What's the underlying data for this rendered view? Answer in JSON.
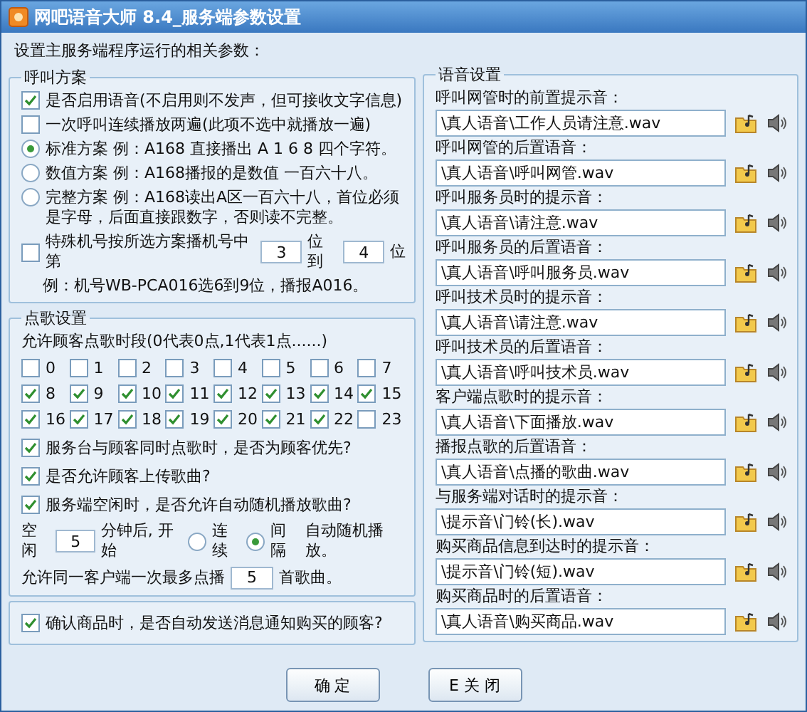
{
  "window": {
    "title": "网吧语音大师 8.4_服务端参数设置"
  },
  "intro": "设置主服务端程序运行的相关参数：",
  "call_scheme": {
    "title": "呼叫方案",
    "items": [
      {
        "kind": "checkbox",
        "label": "是否启用语音(不启用则不发声，但可接收文字信息)",
        "checked": true
      },
      {
        "kind": "checkbox",
        "label": "一次呼叫连续播放两遍(此项不选中就播放一遍)",
        "checked": false
      },
      {
        "kind": "radio",
        "label": "标准方案 例：A168 直接播出 A 1 6 8 四个字符。",
        "selected": true
      },
      {
        "kind": "radio",
        "label": "数值方案 例：A168播报的是数值 一百六十八。",
        "selected": false
      },
      {
        "kind": "radio",
        "label": "完整方案 例：A168读出A区一百六十八，首位必须是字母，后面直接跟数字，否则读不完整。",
        "selected": false
      }
    ],
    "special": {
      "checked": false,
      "label": "特殊机号按所选方案播机号中第",
      "from": "3",
      "middle": "位到",
      "to": "4",
      "end": "位",
      "example": "例：机号WB-PCA016选6到9位，播报A016。"
    }
  },
  "song_settings": {
    "title": "点歌设置",
    "hours_label": "允许顾客点歌时段(0代表0点,1代表1点......)",
    "hours": [
      {
        "label": "0",
        "checked": false
      },
      {
        "label": "1",
        "checked": false
      },
      {
        "label": "2",
        "checked": false
      },
      {
        "label": "3",
        "checked": false
      },
      {
        "label": "4",
        "checked": false
      },
      {
        "label": "5",
        "checked": false
      },
      {
        "label": "6",
        "checked": false
      },
      {
        "label": "7",
        "checked": false
      },
      {
        "label": "8",
        "checked": true
      },
      {
        "label": "9",
        "checked": true
      },
      {
        "label": "10",
        "checked": true
      },
      {
        "label": "11",
        "checked": true
      },
      {
        "label": "12",
        "checked": true
      },
      {
        "label": "13",
        "checked": true
      },
      {
        "label": "14",
        "checked": true
      },
      {
        "label": "15",
        "checked": true
      },
      {
        "label": "16",
        "checked": true
      },
      {
        "label": "17",
        "checked": true
      },
      {
        "label": "18",
        "checked": true
      },
      {
        "label": "19",
        "checked": true
      },
      {
        "label": "20",
        "checked": true
      },
      {
        "label": "21",
        "checked": true
      },
      {
        "label": "22",
        "checked": true
      },
      {
        "label": "23",
        "checked": false
      }
    ],
    "options": [
      {
        "label": "服务台与顾客同时点歌时，是否为顾客优先?",
        "checked": true
      },
      {
        "label": "是否允许顾客上传歌曲?",
        "checked": true
      },
      {
        "label": "服务端空闲时，是否允许自动随机播放歌曲?",
        "checked": true
      }
    ],
    "idle": {
      "before": "空闲",
      "minutes": "5",
      "after": "分钟后, 开始",
      "modes": [
        {
          "label": "连续",
          "selected": false
        },
        {
          "label": "间隔",
          "selected": true
        }
      ],
      "tail": "自动随机播放。"
    },
    "limit": {
      "before": "允许同一客户端一次最多点播",
      "value": "5",
      "after": "首歌曲。"
    }
  },
  "confirm_option": {
    "label": "确认商品时，是否自动发送消息通知购买的顾客?",
    "checked": true
  },
  "voice_settings": {
    "title": "语音设置",
    "entries": [
      {
        "label": "呼叫网管时的前置提示音：",
        "value": "\\真人语音\\工作人员请注意.wav"
      },
      {
        "label": "呼叫网管的后置语音：",
        "value": "\\真人语音\\呼叫网管.wav"
      },
      {
        "label": "呼叫服务员时的提示音：",
        "value": "\\真人语音\\请注意.wav"
      },
      {
        "label": "呼叫服务员的后置语音：",
        "value": "\\真人语音\\呼叫服务员.wav"
      },
      {
        "label": "呼叫技术员时的提示音：",
        "value": "\\真人语音\\请注意.wav"
      },
      {
        "label": "呼叫技术员的后置语音：",
        "value": "\\真人语音\\呼叫技术员.wav"
      },
      {
        "label": "客户端点歌时的提示音：",
        "value": "\\真人语音\\下面播放.wav"
      },
      {
        "label": "播报点歌的后置语音：",
        "value": "\\真人语音\\点播的歌曲.wav"
      },
      {
        "label": "与服务端对话时的提示音：",
        "value": "\\提示音\\门铃(长).wav"
      },
      {
        "label": "购买商品信息到达时的提示音：",
        "value": "\\提示音\\门铃(短).wav"
      },
      {
        "label": "购买商品时的后置语音：",
        "value": "\\真人语音\\购买商品.wav"
      }
    ]
  },
  "buttons": [
    {
      "label": "确 定"
    },
    {
      "label": "E 关 闭"
    }
  ]
}
